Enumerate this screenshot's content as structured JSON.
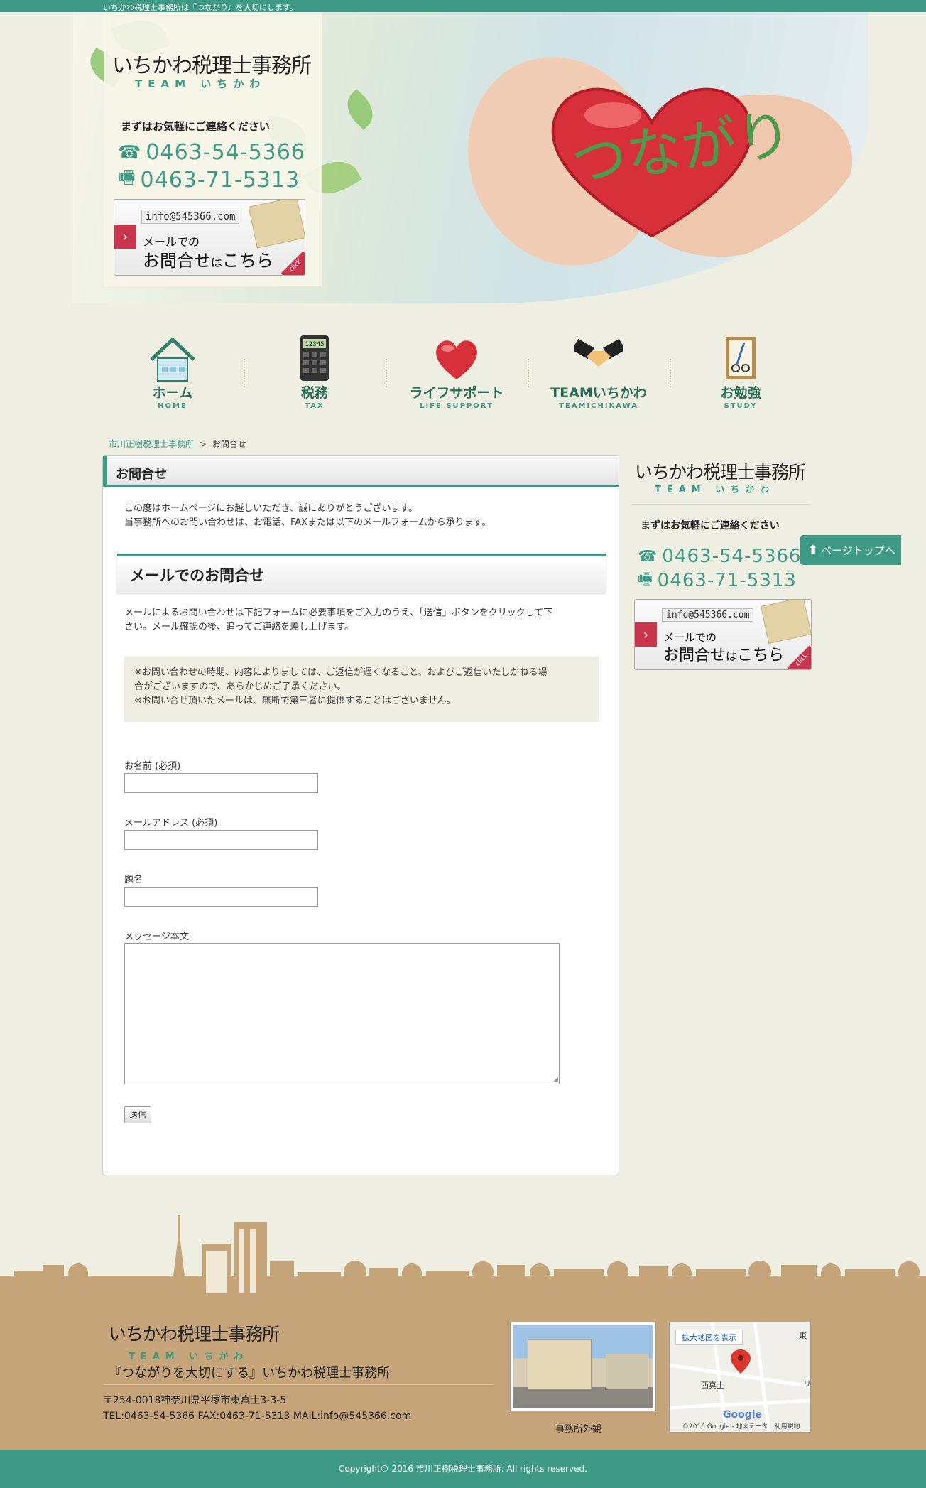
{
  "top_tagline": "いちかわ税理士事務所は『つながり』を大切にします。",
  "hero": {
    "heart_text": "つながり"
  },
  "brand": {
    "name": "いちかわ税理士事務所",
    "sub": "TEAM いちかわ"
  },
  "contact": {
    "lead": "まずはお気軽にご連絡ください",
    "tel": "0463-54-5366",
    "fax": "0463-71-5313",
    "mail_button": {
      "address": "info@545366.com",
      "line1": "メールでの",
      "line2a": "お問合せ",
      "line2b": "は",
      "line2c": "こちら",
      "click": "click"
    }
  },
  "nav": [
    {
      "label": "ホーム",
      "sub": "HOME"
    },
    {
      "label": "税務",
      "sub": "TAX"
    },
    {
      "label": "ライフサポート",
      "sub": "LIFE SUPPORT"
    },
    {
      "label": "TEAMいちかわ",
      "sub": "TEAMICHIKAWA"
    },
    {
      "label": "お勉強",
      "sub": "STUDY"
    }
  ],
  "calculator_display": "12345",
  "breadcrumb": {
    "home": "市川正樹税理士事務所",
    "sep": ">",
    "current": "お問合せ"
  },
  "main": {
    "title": "お問合せ",
    "intro1": "この度はホームページにお越しいただき、誠にありがとうございます。",
    "intro2": "当事務所へのお問い合わせは、お電話、FAXまたは以下のメールフォームから承ります。",
    "section_title": "メールでのお問合せ",
    "desc1": "メールによるお問い合わせは下記フォームに必要事項をご入力のうえ、「送信」ボタンをクリックして下",
    "desc2": "さい。メール確認の後、追ってご連絡を差し上げます。",
    "note1": "※お問い合わせの時期、内容によりましては、ご返信が遅くなること、およびご返信いたしかねる場",
    "note2": "合がございますので、あらかじめご了承ください。",
    "note3": "※お問い合せ頂いたメールは、無断で第三者に提供することはございません。",
    "form": {
      "name_label": "お名前 (必須)",
      "email_label": "メールアドレス (必須)",
      "subject_label": "題名",
      "message_label": "メッセージ本文",
      "submit": "送信"
    }
  },
  "pagetop": "ページトップへ",
  "footer": {
    "tagline": "『つながりを大切にする』いちかわ税理士事務所",
    "address": "〒254-0018神奈川県平塚市東真土3-3-5",
    "contact_line": "TEL:0463-54-5366 FAX:0463-71-5313 MAIL:info@545366.com",
    "photo_caption": "事務所外観",
    "map_button": "拡大地図を表示",
    "map_label_nishi": "西真土",
    "map_label_east": "東",
    "map_label_ri": "リ",
    "map_google": "Google",
    "map_copy": "©2016 Google - 地図データ　利用規約"
  },
  "copyright": "Copyright© 2016 市川正樹税理士事務所. All rights reserved.",
  "colors": {
    "accent": "#3f9a85",
    "background": "#efeee2",
    "footer": "#c5a47a",
    "cta_red": "#c8364d"
  }
}
